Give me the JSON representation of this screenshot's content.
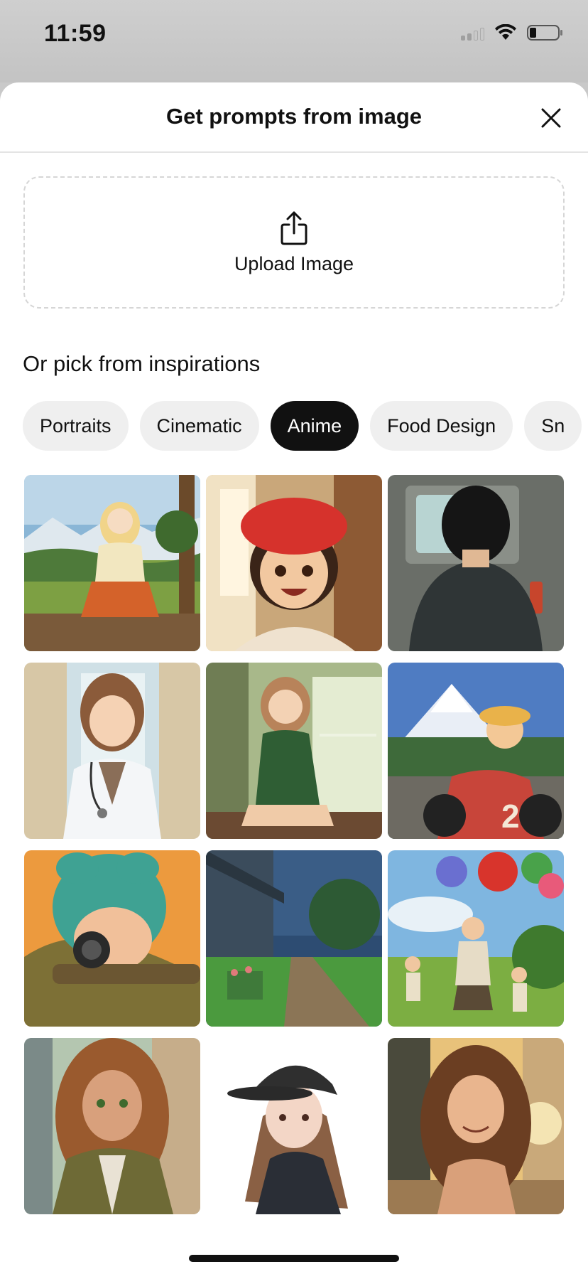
{
  "status_bar": {
    "time": "11:59"
  },
  "sheet": {
    "title": "Get prompts from image",
    "close_icon": "close-icon"
  },
  "upload": {
    "label": "Upload Image",
    "icon": "share-upload-icon"
  },
  "inspirations": {
    "title": "Or pick from inspirations",
    "categories": [
      "Portraits",
      "Cinematic",
      "Anime",
      "Food Design",
      "Sn"
    ],
    "selected": "Anime"
  },
  "gallery": {
    "images": [
      "anime-girl-sitting-on-log-in-meadow",
      "anime-boy-red-cap-smiling",
      "anime-boy-back-facing-tv",
      "anime-doctor-with-stethoscope",
      "anime-girl-green-dress-by-window",
      "anime-race-car-driver-mount-fuji",
      "anime-girl-teal-hair-with-rifle-scope",
      "anime-rainy-path-by-house",
      "anime-kids-running-with-balloons",
      "anime-girl-long-brown-hair-uniform",
      "anime-girl-black-cap",
      "anime-girl-sunset-street"
    ]
  },
  "colors": {
    "accent": "#111111",
    "chip_bg": "#efefef",
    "sheet_bg": "#ffffff"
  }
}
